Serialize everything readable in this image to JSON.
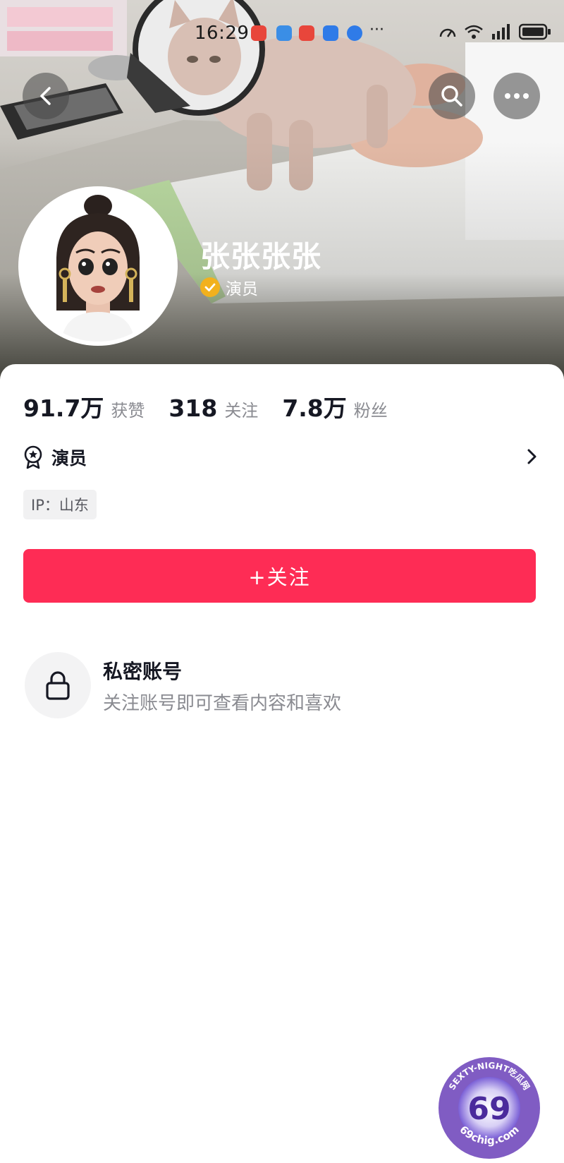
{
  "status_bar": {
    "time": "16:29",
    "overflow_dots": "···",
    "notification_colors": [
      "#e8463b",
      "#3a8ee6",
      "#e8463b",
      "#2f7be8",
      "#2f7be8"
    ]
  },
  "header": {
    "back_icon": "chevron-left-icon",
    "search_icon": "search-icon",
    "more_icon": "more-horizontal-icon"
  },
  "profile": {
    "nickname": "张张张张",
    "verified_label": "演员",
    "verified_color": "#f2b11d"
  },
  "stats": [
    {
      "value": "91.7万",
      "label": "获赞"
    },
    {
      "value": "318",
      "label": "关注"
    },
    {
      "value": "7.8万",
      "label": "粉丝"
    }
  ],
  "role": {
    "label": "演员",
    "icon": "award-badge-icon"
  },
  "ip": {
    "label": "IP：山东"
  },
  "follow_button": {
    "label": "+关注",
    "color": "#fe2c55"
  },
  "private_account": {
    "icon": "lock-icon",
    "title": "私密账号",
    "subtitle": "关注账号即可查看内容和喜欢"
  },
  "watermark": {
    "top_text": "SEXTY-NIGHT吃瓜网",
    "center_text": "69",
    "bottom_text": "69chig.com"
  }
}
